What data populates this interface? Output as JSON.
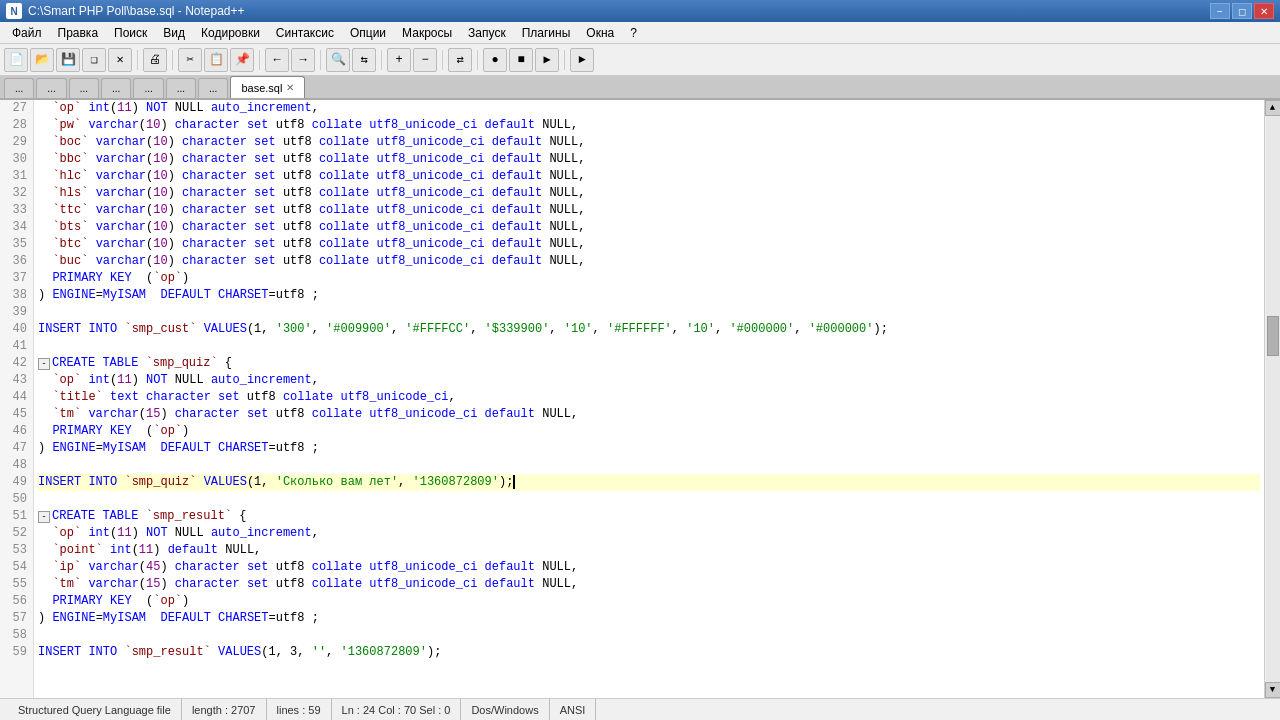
{
  "titleBar": {
    "title": "C:\\Smart PHP Poll\\base.sql - Notepad++",
    "icon": "N++"
  },
  "menuBar": {
    "items": [
      "Файл",
      "Правка",
      "Поиск",
      "Вид",
      "Кодировки",
      "Синтаксис",
      "Опции",
      "Макросы",
      "Запуск",
      "Плагины",
      "Окна",
      "?"
    ]
  },
  "tabs": [
    {
      "label": "...",
      "active": false
    },
    {
      "label": "...",
      "active": false
    },
    {
      "label": "...",
      "active": false
    },
    {
      "label": "...",
      "active": false
    },
    {
      "label": "...",
      "active": false
    },
    {
      "label": "...",
      "active": false
    },
    {
      "label": "...",
      "active": false
    },
    {
      "label": "base.sql",
      "active": true
    }
  ],
  "lines": [
    {
      "num": 27,
      "text": "  `op` int(11) NOT NULL auto_increment,"
    },
    {
      "num": 28,
      "text": "  `pw` varchar(10) character set utf8 collate utf8_unicode_ci default NULL,"
    },
    {
      "num": 29,
      "text": "  `boc` varchar(10) character set utf8 collate utf8_unicode_ci default NULL,"
    },
    {
      "num": 30,
      "text": "  `bbc` varchar(10) character set utf8 collate utf8_unicode_ci default NULL,"
    },
    {
      "num": 31,
      "text": "  `hlc` varchar(10) character set utf8 collate utf8_unicode_ci default NULL,"
    },
    {
      "num": 32,
      "text": "  `hls` varchar(10) character set utf8 collate utf8_unicode_ci default NULL,"
    },
    {
      "num": 33,
      "text": "  `ttc` varchar(10) character set utf8 collate utf8_unicode_ci default NULL,"
    },
    {
      "num": 34,
      "text": "  `bts` varchar(10) character set utf8 collate utf8_unicode_ci default NULL,"
    },
    {
      "num": 35,
      "text": "  `btc` varchar(10) character set utf8 collate utf8_unicode_ci default NULL,"
    },
    {
      "num": 36,
      "text": "  `buc` varchar(10) character set utf8 collate utf8_unicode_ci default NULL,"
    },
    {
      "num": 37,
      "text": "  PRIMARY KEY  (`op`)"
    },
    {
      "num": 38,
      "text": ") ENGINE=MyISAM  DEFAULT CHARSET=utf8 ;"
    },
    {
      "num": 39,
      "text": ""
    },
    {
      "num": 40,
      "text": "INSERT INTO `smp_cust` VALUES(1, '300', '#009900', '#FFFFCC', '$339900', '10', '#FFFFFF', '10', '#000000', '#000000');"
    },
    {
      "num": 41,
      "text": ""
    },
    {
      "num": 42,
      "text": "CREATE TABLE `smp_quiz` {",
      "hasFold": true
    },
    {
      "num": 43,
      "text": "  `op` int(11) NOT NULL auto_increment,"
    },
    {
      "num": 44,
      "text": "  `title` text character set utf8 collate utf8_unicode_ci,"
    },
    {
      "num": 45,
      "text": "  `tm` varchar(15) character set utf8 collate utf8_unicode_ci default NULL,"
    },
    {
      "num": 46,
      "text": "  PRIMARY KEY  (`op`)"
    },
    {
      "num": 47,
      "text": ") ENGINE=MyISAM  DEFAULT CHARSET=utf8 ;"
    },
    {
      "num": 48,
      "text": ""
    },
    {
      "num": 49,
      "text": "INSERT INTO `smp_quiz` VALUES(1, 'Сколько вам лет', '1360872809');",
      "cursor": true
    },
    {
      "num": 50,
      "text": ""
    },
    {
      "num": 51,
      "text": "CREATE TABLE `smp_result` {",
      "hasFold": true
    },
    {
      "num": 52,
      "text": "  `op` int(11) NOT NULL auto_increment,"
    },
    {
      "num": 53,
      "text": "  `point` int(11) default NULL,"
    },
    {
      "num": 54,
      "text": "  `ip` varchar(45) character set utf8 collate utf8_unicode_ci default NULL,"
    },
    {
      "num": 55,
      "text": "  `tm` varchar(15) character set utf8 collate utf8_unicode_ci default NULL,"
    },
    {
      "num": 56,
      "text": "  PRIMARY KEY  (`op`)"
    },
    {
      "num": 57,
      "text": ") ENGINE=MyISAM  DEFAULT CHARSET=utf8 ;"
    },
    {
      "num": 58,
      "text": ""
    },
    {
      "num": 59,
      "text": "INSERT INTO `smp_result` VALUES(1, 3, '', '1360872809');"
    }
  ],
  "statusBar": {
    "fileType": "Structured Query Language file",
    "length": "length : 2707",
    "lines": "lines : 59",
    "position": "Ln : 24   Col : 70   Sel : 0",
    "lineEnding": "Dos/Windows",
    "encoding": "ANSI"
  }
}
